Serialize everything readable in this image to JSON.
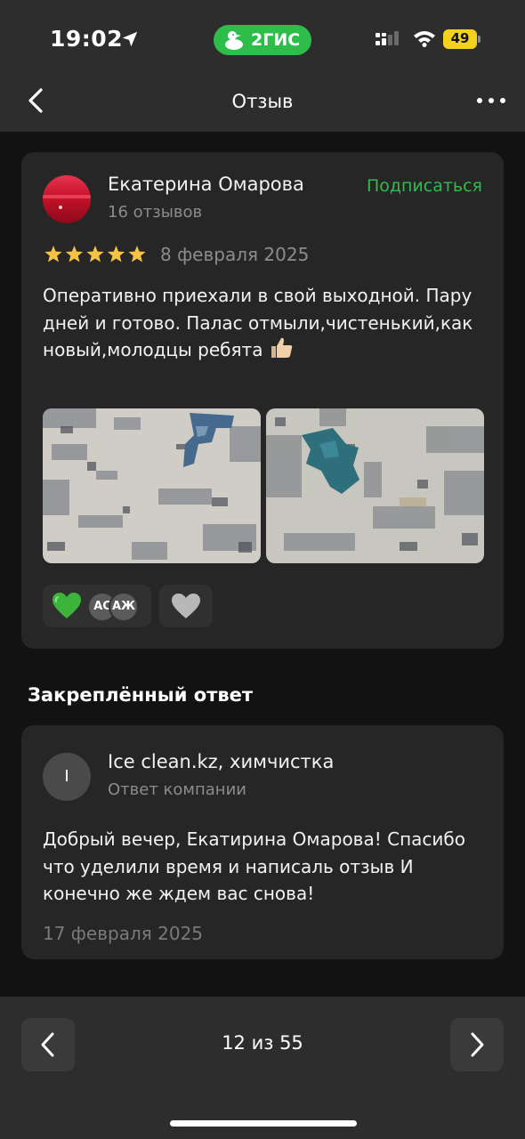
{
  "status_bar": {
    "time": "19:02",
    "app_badge": "2ГИС",
    "battery": "49"
  },
  "nav": {
    "title": "Отзыв"
  },
  "review": {
    "author": "Екатерина Омарова",
    "reviews_count": "16 отзывов",
    "subscribe_label": "Подписаться",
    "rating": 5,
    "date": "8 февраля 2025",
    "text": "Оперативно приехали в свой выходной. Пару дней и готово. Палас отмыли,чистенький,как новый,молодцы ребята",
    "reactions": {
      "avatar_1": "АС",
      "avatar_2": "АЖ"
    }
  },
  "pinned": {
    "title": "Закреплённый ответ",
    "avatar_letter": "I",
    "company": "Ice clean.kz, химчистка",
    "subtitle": "Ответ компании",
    "text": "Добрый вечер, Екатирина Омарова! Спасибо что уделили время и написаль отзыв И конечно же ждем вас снова!",
    "date": "17 февраля 2025"
  },
  "pagination": {
    "label": "12 из 55"
  },
  "colors": {
    "accent_green": "#2ebd4b",
    "star": "#f6c243",
    "background": "#121212",
    "card": "#262626"
  }
}
